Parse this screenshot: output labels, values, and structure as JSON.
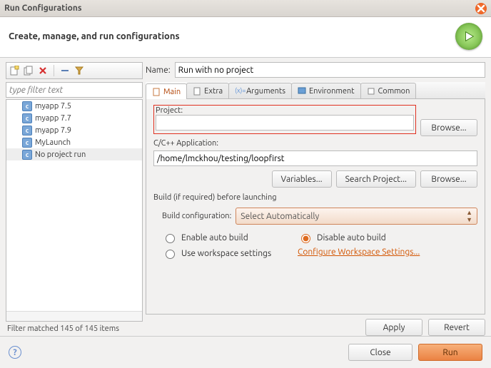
{
  "window": {
    "title": "Run Configurations"
  },
  "header": {
    "subtitle": "Create, manage, and run configurations"
  },
  "sidebar": {
    "filter_placeholder": "type filter text",
    "items": [
      {
        "label": "myapp 7.5"
      },
      {
        "label": "myapp 7.7"
      },
      {
        "label": "myapp 7.9"
      },
      {
        "label": "MyLaunch"
      },
      {
        "label": "No project run"
      }
    ],
    "status": "Filter matched 145 of 145 items"
  },
  "form": {
    "name_label": "Name:",
    "name_value": "Run with no project",
    "tabs": [
      {
        "label": "Main"
      },
      {
        "label": "Extra"
      },
      {
        "label": "Arguments"
      },
      {
        "label": "Environment"
      },
      {
        "label": "Common"
      }
    ],
    "project": {
      "label": "Project:",
      "value": "",
      "browse": "Browse..."
    },
    "app": {
      "label": "C/C++ Application:",
      "value": "/home/lmckhou/testing/loopfirst",
      "variables": "Variables...",
      "search": "Search Project...",
      "browse": "Browse..."
    },
    "build": {
      "section": "Build (if required) before launching",
      "config_label": "Build configuration:",
      "config_value": "Select Automatically",
      "enable": "Enable auto build",
      "disable": "Disable auto build",
      "workspace": "Use workspace settings",
      "configure": "Configure Workspace Settings..."
    },
    "apply": "Apply",
    "revert": "Revert"
  },
  "footer": {
    "close": "Close",
    "run": "Run"
  }
}
